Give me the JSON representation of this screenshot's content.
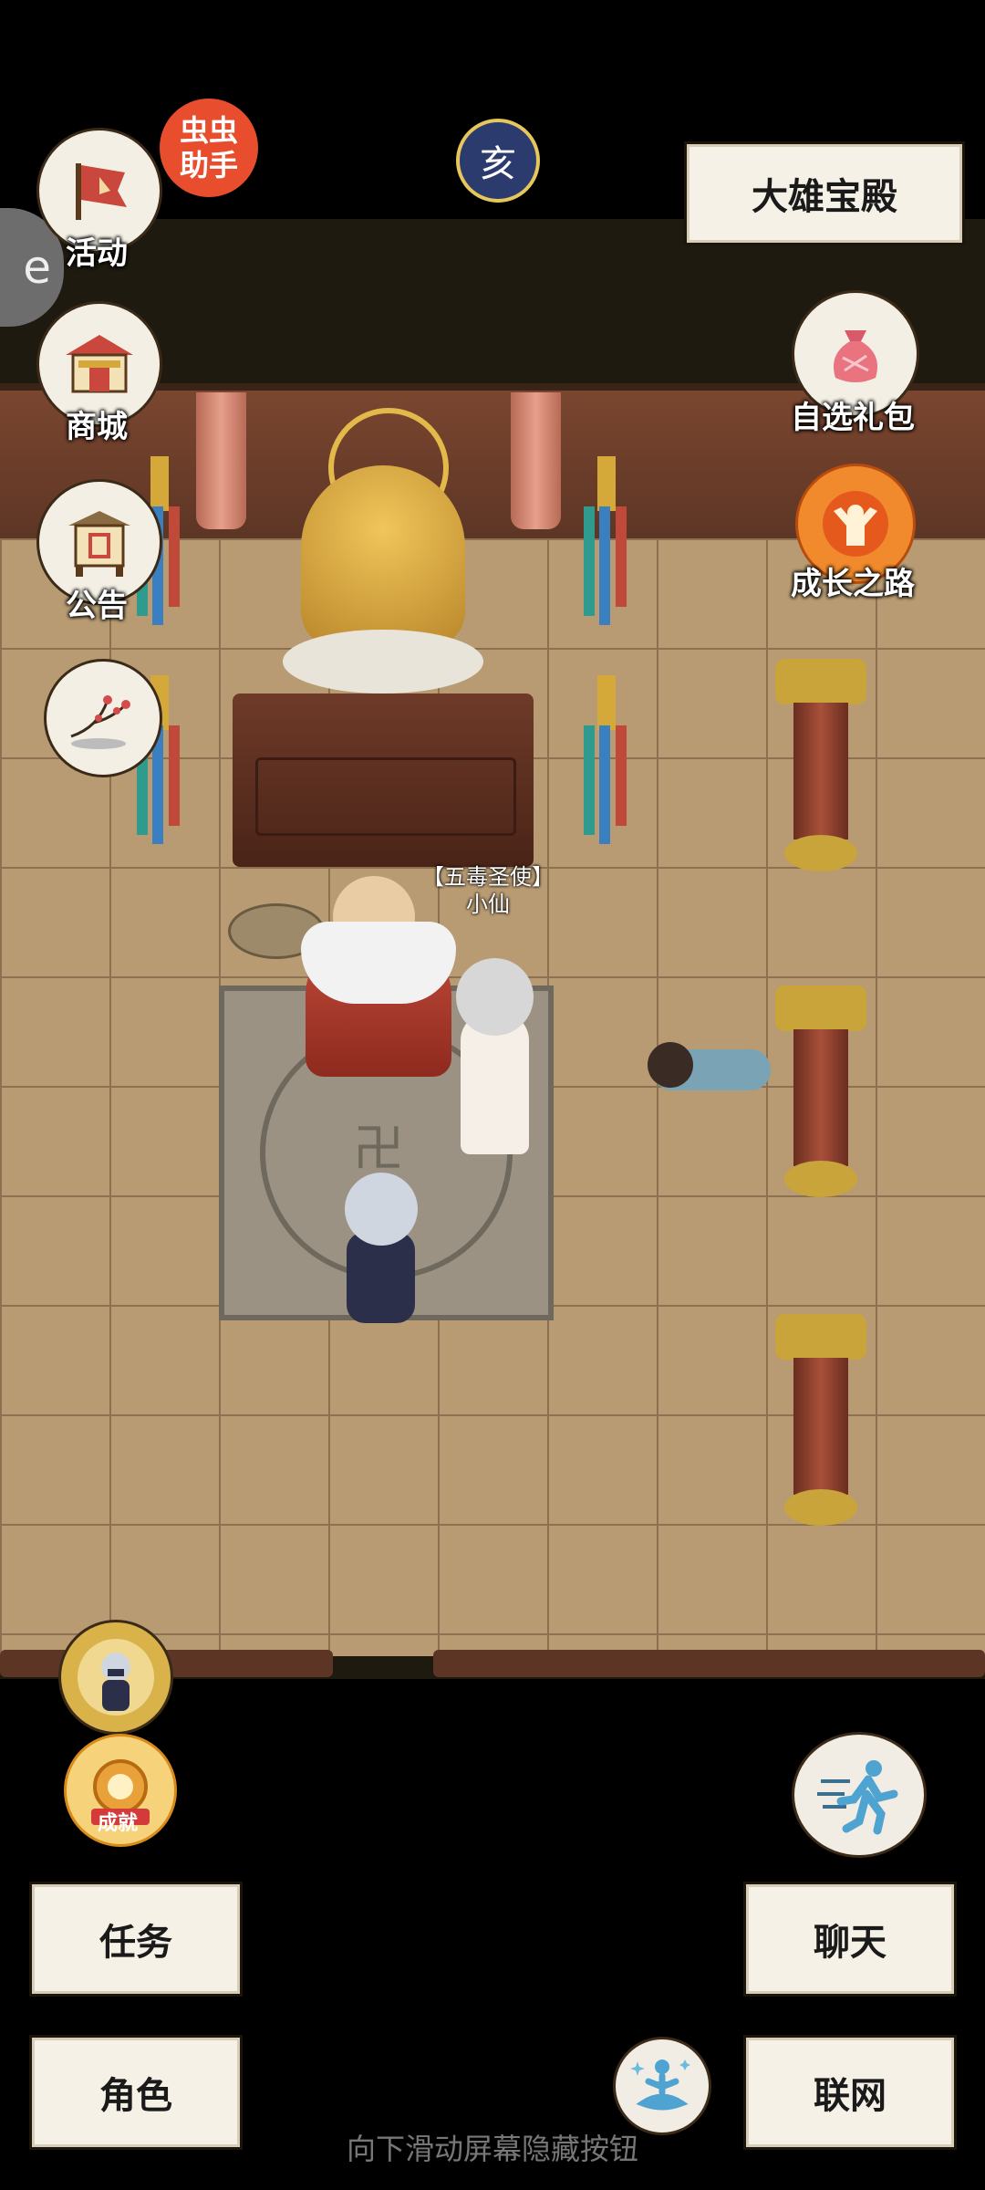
{
  "hud": {
    "helper_badge": "虫虫\n助手",
    "location": "大雄宝殿",
    "day_glyph": "亥",
    "side_tab_glyph": "e"
  },
  "left_menu": [
    {
      "label": "活动",
      "icon": "flag-icon"
    },
    {
      "label": "商城",
      "icon": "shop-icon"
    },
    {
      "label": "公告",
      "icon": "notice-board-icon"
    },
    {
      "label": "",
      "icon": "plum-blossom-icon"
    }
  ],
  "right_menu": [
    {
      "label": "自选礼包",
      "icon": "gift-bag-icon"
    },
    {
      "label": "成长之路",
      "icon": "growth-path-icon"
    }
  ],
  "npc": {
    "title": "【五毒圣使】",
    "name": "小仙"
  },
  "bottom": {
    "achievement_label": "成就",
    "task": "任务",
    "role": "角色",
    "chat": "聊天",
    "network": "联网"
  },
  "hint": "向下滑动屏幕隐藏按钮",
  "colors": {
    "panel": "#f6f1e6",
    "helper": "#e84e2e",
    "floor": "#b89b73",
    "wall": "#5c3524"
  }
}
